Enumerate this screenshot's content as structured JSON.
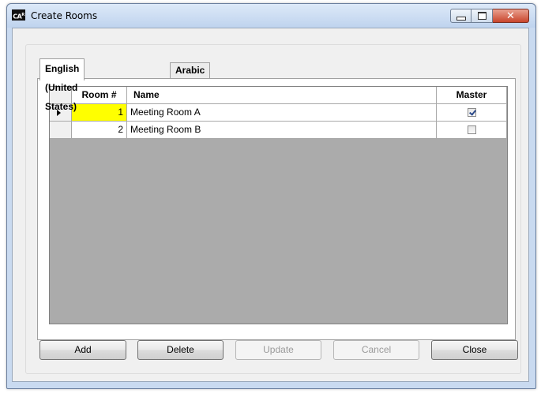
{
  "window": {
    "title": "Create Rooms",
    "icon_text": "CA",
    "icon_superscript": "R"
  },
  "tabs": [
    {
      "label": "English (United States)",
      "active": true
    },
    {
      "label": "Arabic",
      "active": false
    }
  ],
  "grid": {
    "columns": {
      "room": "Room #",
      "name": "Name",
      "master": "Master"
    },
    "rows": [
      {
        "room": "1",
        "name": "Meeting Room A",
        "master": true,
        "current": true
      },
      {
        "room": "2",
        "name": "Meeting Room B",
        "master": false,
        "current": false
      }
    ]
  },
  "buttons": {
    "add": "Add",
    "delete": "Delete",
    "update": "Update",
    "cancel": "Cancel",
    "close": "Close"
  },
  "colors": {
    "highlight": "#ffff00",
    "grid_background": "#ababab"
  }
}
